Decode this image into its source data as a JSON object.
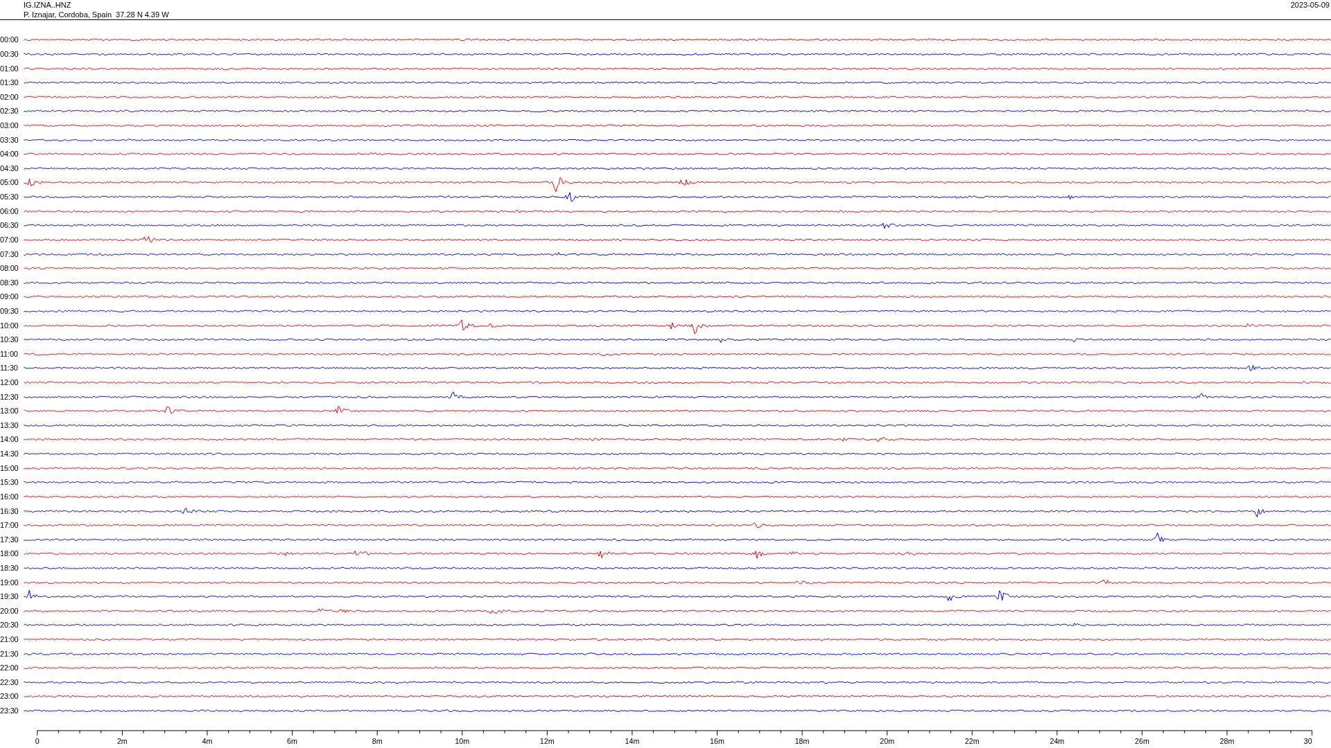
{
  "header": {
    "station": "IG.IZNA..HNZ",
    "location": "P. Iznajar, Cordoba, Spain  37.28 N 4.39 W",
    "date": "2023-05-09"
  },
  "traces": [
    {
      "label": "00:00",
      "color": "#ff0000"
    },
    {
      "label": "00:30",
      "color": "#0000ff"
    },
    {
      "label": "01:00",
      "color": "#ff0000"
    },
    {
      "label": "01:30",
      "color": "#0000ff"
    },
    {
      "label": "02:00",
      "color": "#ff0000"
    },
    {
      "label": "02:30",
      "color": "#0000ff"
    },
    {
      "label": "03:00",
      "color": "#ff0000"
    },
    {
      "label": "03:30",
      "color": "#0000ff"
    },
    {
      "label": "04:00",
      "color": "#ff0000"
    },
    {
      "label": "04:30",
      "color": "#0000ff"
    },
    {
      "label": "05:00",
      "color": "#ff0000"
    },
    {
      "label": "05:30",
      "color": "#0000ff"
    },
    {
      "label": "06:00",
      "color": "#ff0000"
    },
    {
      "label": "06:30",
      "color": "#0000ff"
    },
    {
      "label": "07:00",
      "color": "#ff0000"
    },
    {
      "label": "07:30",
      "color": "#0000ff"
    },
    {
      "label": "08:00",
      "color": "#ff0000"
    },
    {
      "label": "08:30",
      "color": "#0000ff"
    },
    {
      "label": "09:00",
      "color": "#ff0000"
    },
    {
      "label": "09:30",
      "color": "#0000ff"
    },
    {
      "label": "10:00",
      "color": "#ff0000"
    },
    {
      "label": "10:30",
      "color": "#0000ff"
    },
    {
      "label": "11:00",
      "color": "#ff0000"
    },
    {
      "label": "11:30",
      "color": "#0000ff"
    },
    {
      "label": "12:00",
      "color": "#ff0000"
    },
    {
      "label": "12:30",
      "color": "#0000ff"
    },
    {
      "label": "13:00",
      "color": "#ff0000"
    },
    {
      "label": "13:30",
      "color": "#0000ff"
    },
    {
      "label": "14:00",
      "color": "#ff0000"
    },
    {
      "label": "14:30",
      "color": "#0000ff"
    },
    {
      "label": "15:00",
      "color": "#ff0000"
    },
    {
      "label": "15:30",
      "color": "#0000ff"
    },
    {
      "label": "16:00",
      "color": "#ff0000"
    },
    {
      "label": "16:30",
      "color": "#0000ff"
    },
    {
      "label": "17:00",
      "color": "#ff0000"
    },
    {
      "label": "17:30",
      "color": "#0000ff"
    },
    {
      "label": "18:00",
      "color": "#ff0000"
    },
    {
      "label": "18:30",
      "color": "#0000ff"
    },
    {
      "label": "19:00",
      "color": "#ff0000"
    },
    {
      "label": "19:30",
      "color": "#0000ff"
    },
    {
      "label": "20:00",
      "color": "#ff0000"
    },
    {
      "label": "20:30",
      "color": "#0000ff"
    },
    {
      "label": "21:00",
      "color": "#ff0000"
    },
    {
      "label": "21:30",
      "color": "#0000ff"
    },
    {
      "label": "22:00",
      "color": "#ff0000"
    },
    {
      "label": "22:30",
      "color": "#0000ff"
    },
    {
      "label": "23:00",
      "color": "#ff0000"
    },
    {
      "label": "23:30",
      "color": "#0000ff"
    }
  ],
  "x_axis": {
    "tick_labels": [
      "0",
      "2m",
      "4m",
      "6m",
      "8m",
      "10m",
      "12m",
      "14m",
      "16m",
      "18m",
      "20m",
      "22m",
      "24m",
      "26m",
      "28m",
      "30"
    ]
  }
}
